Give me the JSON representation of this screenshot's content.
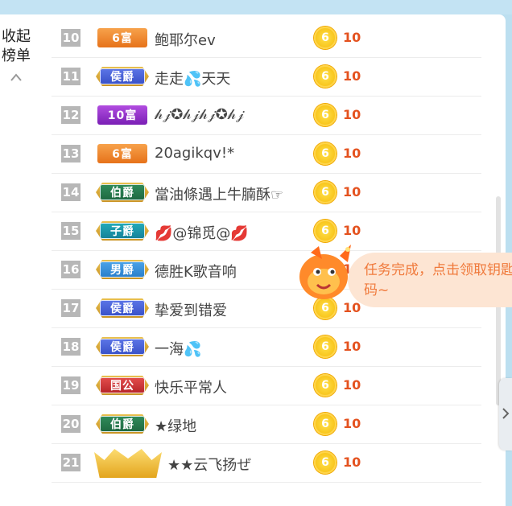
{
  "collapse": {
    "line1": "收起",
    "line2": "榜单"
  },
  "rows": [
    {
      "rank": "10",
      "badge": "6富",
      "badge_type": "rich",
      "name": "鲍耶尔ev",
      "coin": "6",
      "amount": "10"
    },
    {
      "rank": "11",
      "badge": "侯爵",
      "badge_type": "hou",
      "name": "走走💦天天",
      "coin": "6",
      "amount": "10"
    },
    {
      "rank": "12",
      "badge": "10富",
      "badge_type": "rich10",
      "name": "𝒽𝒿✪𝒽𝒿𝒽𝒿✪𝒽𝒿",
      "coin": "6",
      "amount": "10"
    },
    {
      "rank": "13",
      "badge": "6富",
      "badge_type": "rich",
      "name": "20agikqv!*",
      "coin": "6",
      "amount": "10"
    },
    {
      "rank": "14",
      "badge": "伯爵",
      "badge_type": "bo",
      "name": "當油條遇上牛腩酥☞",
      "coin": "6",
      "amount": "10"
    },
    {
      "rank": "15",
      "badge": "子爵",
      "badge_type": "zi",
      "name": "💋@锦觅@💋",
      "coin": "6",
      "amount": "10"
    },
    {
      "rank": "16",
      "badge": "男爵",
      "badge_type": "nan",
      "name": "德胜K歌音响",
      "coin": "6",
      "amount": "10"
    },
    {
      "rank": "17",
      "badge": "侯爵",
      "badge_type": "hou",
      "name": "挚爱到错爱",
      "coin": "6",
      "amount": "10"
    },
    {
      "rank": "18",
      "badge": "侯爵",
      "badge_type": "hou",
      "name": "一海💦",
      "coin": "6",
      "amount": "10"
    },
    {
      "rank": "19",
      "badge": "国公",
      "badge_type": "gong",
      "name": "快乐平常人",
      "coin": "6",
      "amount": "10"
    },
    {
      "rank": "20",
      "badge": "伯爵",
      "badge_type": "bo",
      "name": "★绿地",
      "coin": "6",
      "amount": "10"
    },
    {
      "rank": "21",
      "badge": "",
      "badge_type": "crown",
      "name": "★★云飞扬ぜ",
      "coin": "6",
      "amount": "10"
    }
  ],
  "toast": {
    "message": "任务完成，点击领取钥匙码~"
  },
  "colors": {
    "accent": "#e4521f",
    "toast_text": "#f07a3c",
    "toast_bg": "#fde5d3"
  },
  "icons": {
    "collapse": "chevron-up-icon",
    "side_tab": "chevron-right-icon",
    "mascot": "goldfish-mascot-icon",
    "coin": "coin-icon"
  }
}
